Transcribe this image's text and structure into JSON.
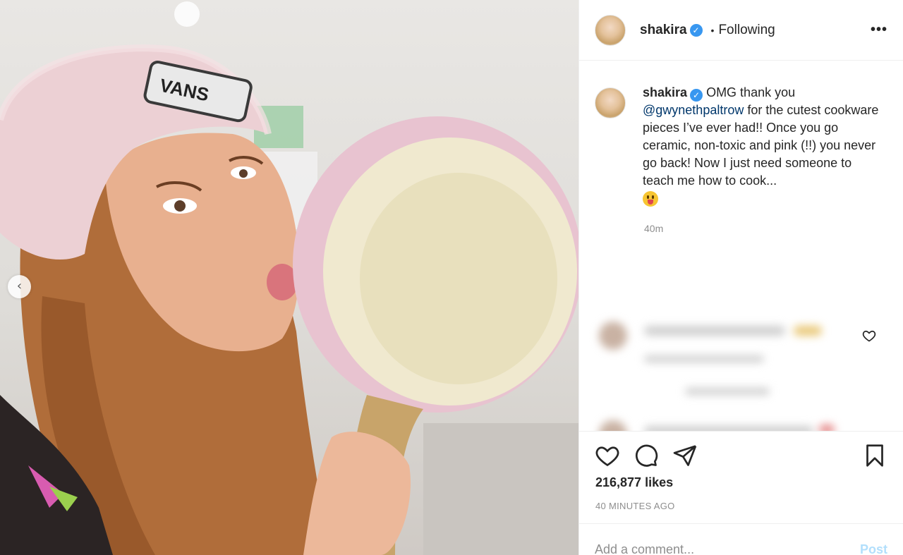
{
  "post": {
    "username": "shakira",
    "follow_status": "Following",
    "separator": "•",
    "more_icon": "more-horizontal-icon",
    "caption": {
      "username": "shakira",
      "before_mention": "OMG thank you ",
      "mention": "@gwynethpaltrow",
      "after_mention": " for the cutest cookware pieces I’ve ever had!! Once you go ceramic, non-toxic and pink (!!) you never go back! Now I just need someone to teach me how to cook...",
      "emoji": "tongue-out-emoji"
    },
    "caption_time": "40m",
    "likes": "216,877 likes",
    "posted_ago": "40 MINUTES AGO",
    "comment_placeholder": "Add a comment...",
    "post_label": "Post",
    "carousel_prev": "‹"
  },
  "icons": {
    "like": "heart-icon",
    "comment": "comment-icon",
    "share": "paper-plane-icon",
    "save": "bookmark-icon",
    "verified": "verified-badge-icon"
  },
  "colors": {
    "verified": "#3897f0",
    "mention": "#00376b",
    "muted": "#8e8e8e",
    "post_button": "#b2dffc"
  }
}
